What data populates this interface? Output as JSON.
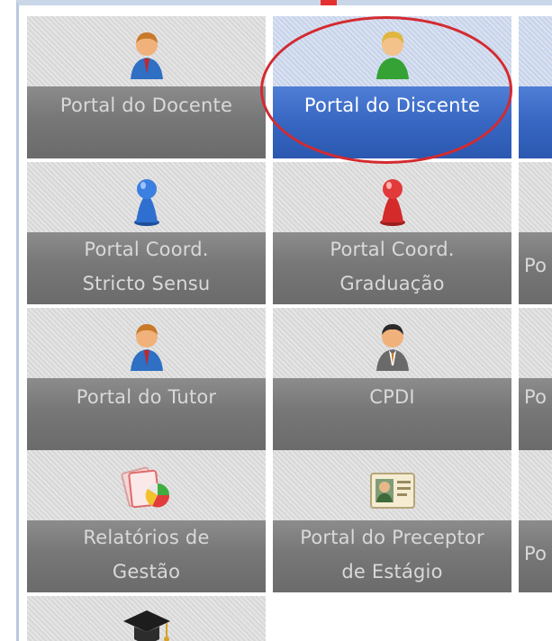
{
  "portals": [
    {
      "lines": [
        "Portal do Docente"
      ],
      "icon": "teacher-person-icon"
    },
    {
      "lines": [
        "Portal do Discente"
      ],
      "icon": "student-person-icon",
      "active": true
    },
    {
      "lines": [
        "Portal Coord.",
        "Stricto Sensu"
      ],
      "icon": "blue-pawn-icon"
    },
    {
      "lines": [
        "Portal Coord.",
        "Graduação"
      ],
      "icon": "red-pawn-icon"
    },
    {
      "lines": [
        "Portal do Tutor"
      ],
      "icon": "tutor-person-icon"
    },
    {
      "lines": [
        "CPDI"
      ],
      "icon": "manager-person-icon"
    },
    {
      "lines": [
        "Relatórios de",
        "Gestão"
      ],
      "icon": "reports-chart-icon"
    },
    {
      "lines": [
        "Portal do Preceptor",
        "de Estágio"
      ],
      "icon": "id-card-icon"
    },
    {
      "lines": [
        ""
      ],
      "icon": "graduation-cap-icon"
    }
  ],
  "partial_column": {
    "row2_label": "Po",
    "row3_label": "Po",
    "row4_label": "Po"
  },
  "colors": {
    "highlight_circle": "#d42a30",
    "active_label": "#2b58b0",
    "tile_label": "#777777"
  }
}
